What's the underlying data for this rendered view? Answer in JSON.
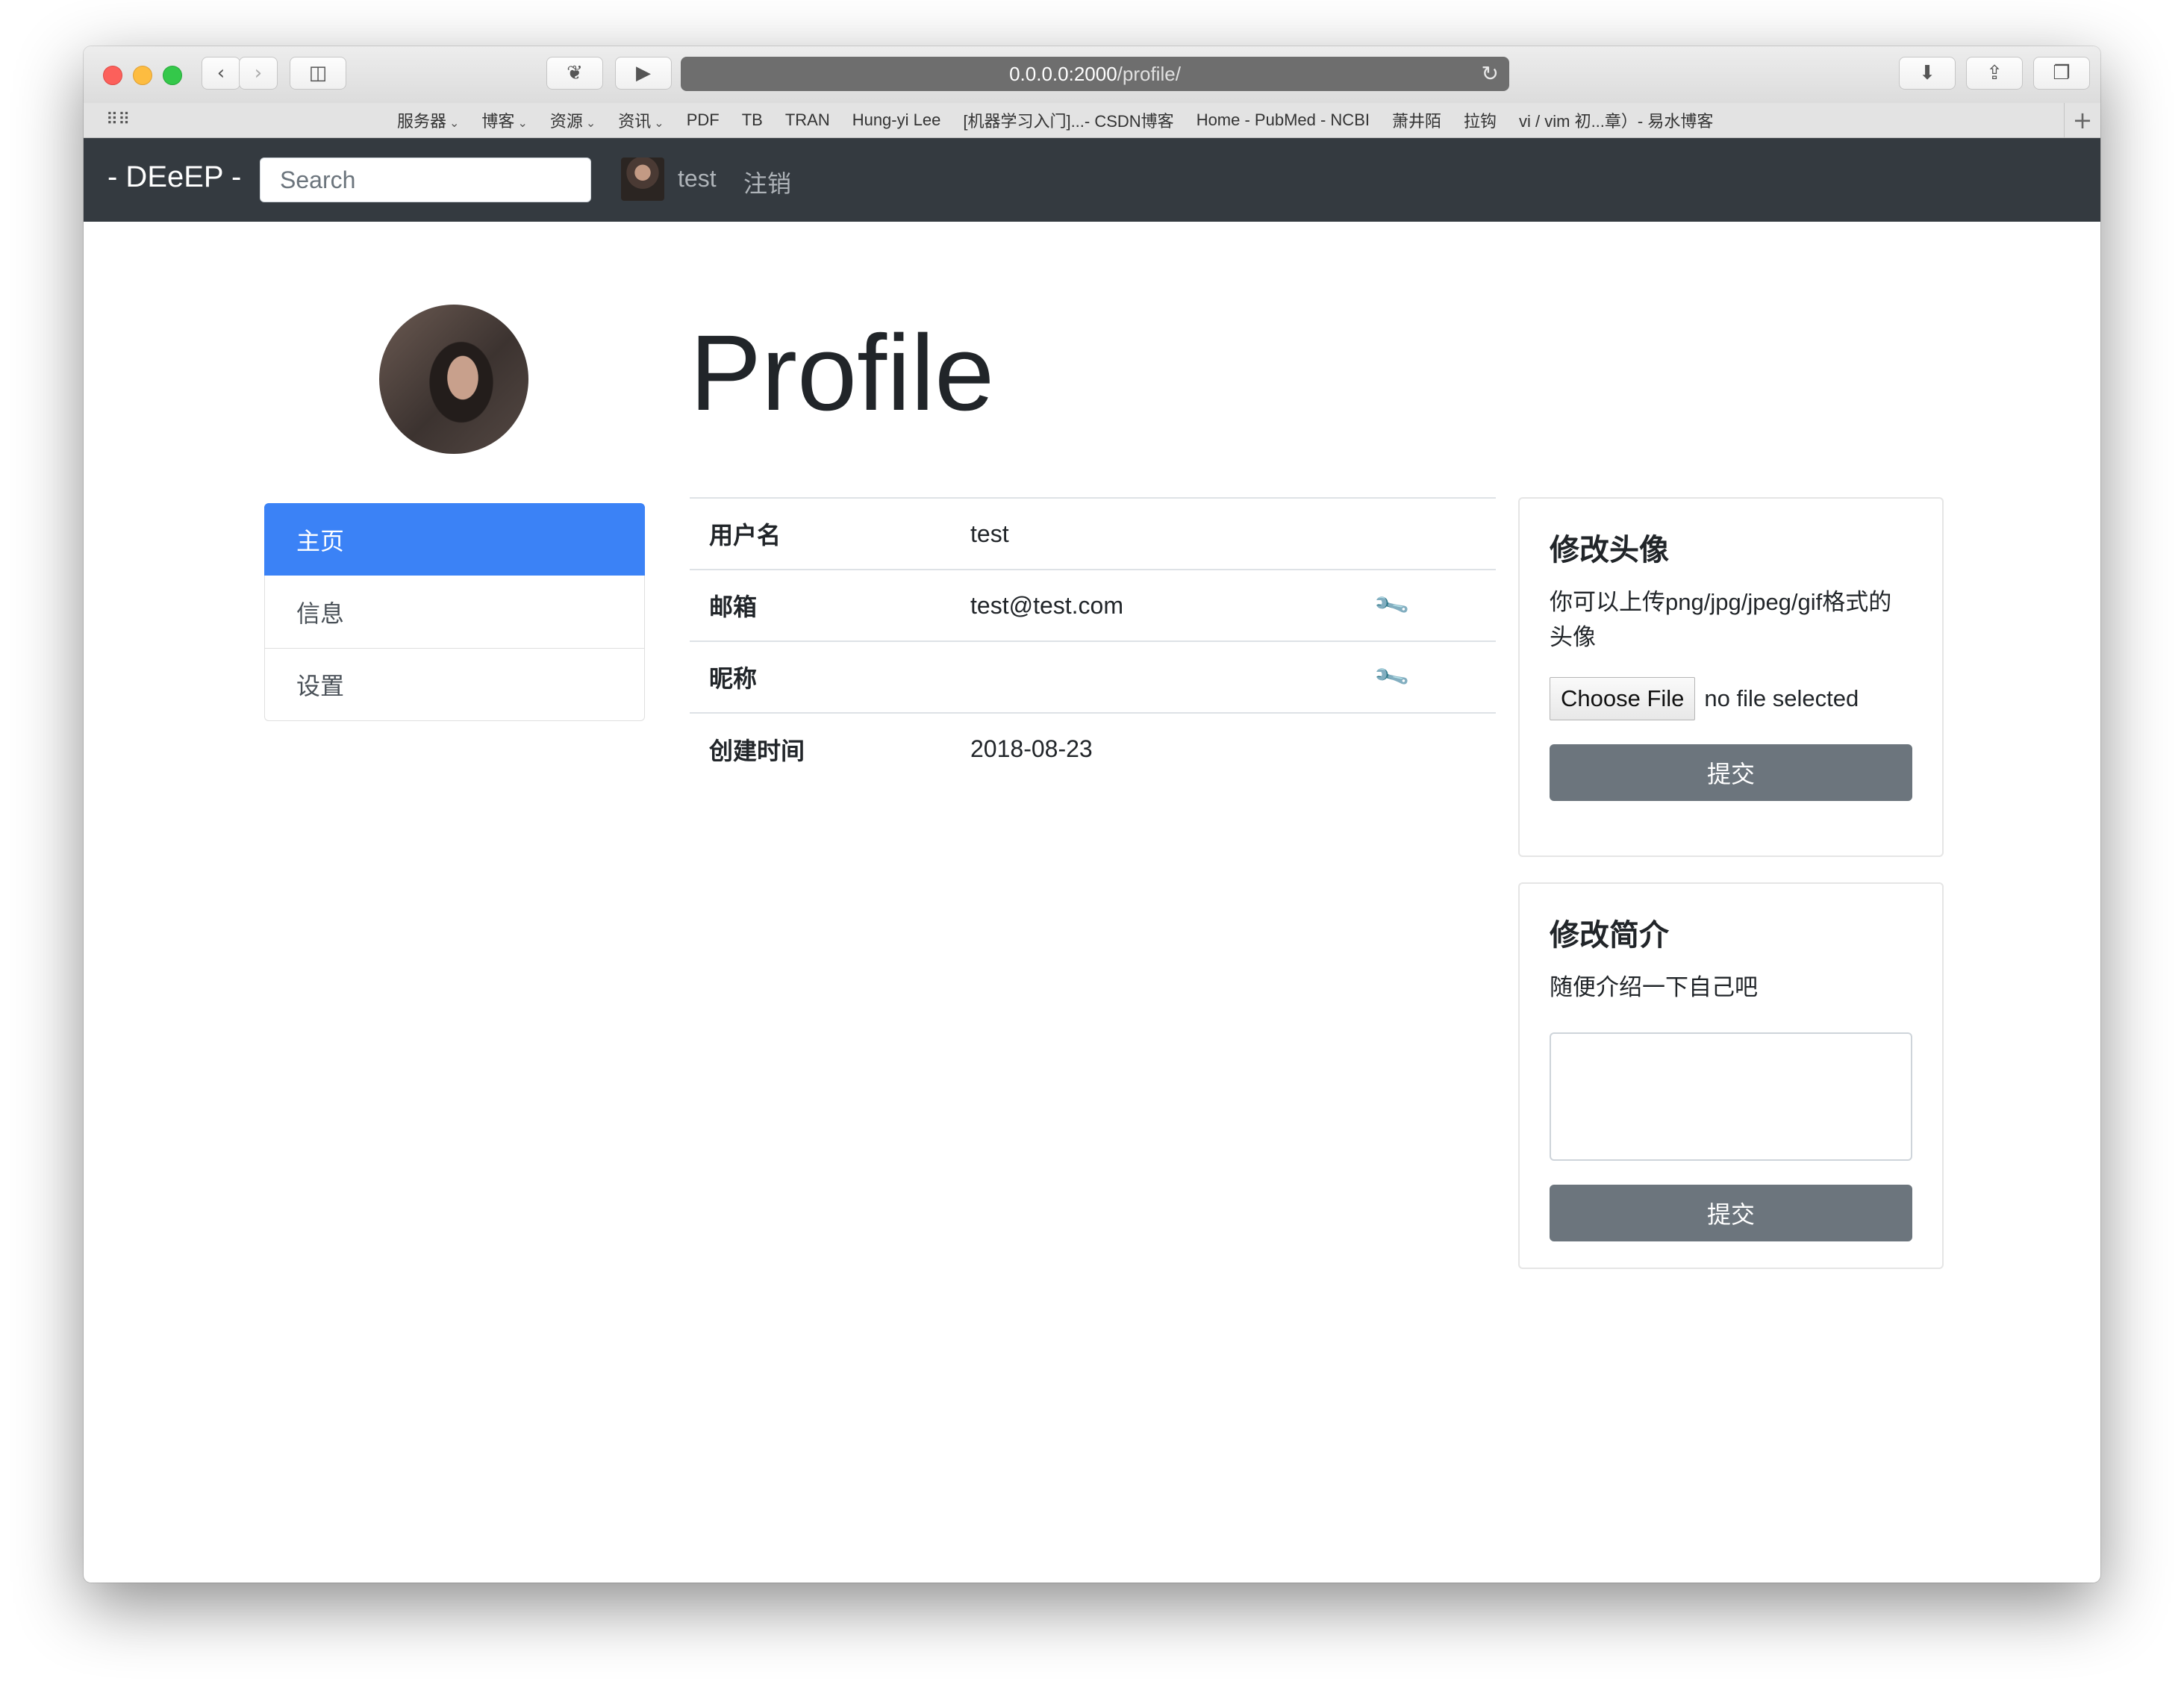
{
  "browser": {
    "url_host": "0.0.0.0:2000",
    "url_path": "/profile/",
    "bookmarks": [
      {
        "label": "服务器",
        "menu": true
      },
      {
        "label": "博客",
        "menu": true
      },
      {
        "label": "资源",
        "menu": true
      },
      {
        "label": "资讯",
        "menu": true
      },
      {
        "label": "PDF",
        "menu": false
      },
      {
        "label": "TB",
        "menu": false
      },
      {
        "label": "TRAN",
        "menu": false
      },
      {
        "label": "Hung-yi Lee",
        "menu": false
      },
      {
        "label": "[机器学习入门]...- CSDN博客",
        "menu": false
      },
      {
        "label": "Home - PubMed - NCBI",
        "menu": false
      },
      {
        "label": "萧井陌",
        "menu": false
      },
      {
        "label": "拉钩",
        "menu": false
      },
      {
        "label": "vi / vim 初...章）- 易水博客",
        "menu": false
      }
    ]
  },
  "navbar": {
    "brand": "- DEeEP -",
    "search_placeholder": "Search",
    "username": "test",
    "logout": "注销"
  },
  "page": {
    "title": "Profile"
  },
  "sidebar": {
    "items": [
      {
        "label": "主页",
        "active": true
      },
      {
        "label": "信息",
        "active": false
      },
      {
        "label": "设置",
        "active": false
      }
    ]
  },
  "info": {
    "rows": [
      {
        "label": "用户名",
        "value": "test",
        "editable": false
      },
      {
        "label": "邮箱",
        "value": "test@test.com",
        "editable": true
      },
      {
        "label": "昵称",
        "value": "",
        "editable": true
      },
      {
        "label": "创建时间",
        "value": "2018-08-23",
        "editable": false
      }
    ]
  },
  "avatar_card": {
    "title": "修改头像",
    "description": "你可以上传png/jpg/jpeg/gif格式的头像",
    "choose_file": "Choose File",
    "no_file": "no file selected",
    "submit": "提交"
  },
  "bio_card": {
    "title": "修改简介",
    "description": "随便介绍一下自己吧",
    "textarea_value": "",
    "submit": "提交"
  },
  "colors": {
    "navbar_bg": "#343a40",
    "active_item": "#3b82f6",
    "submit_button": "#6c757d"
  }
}
